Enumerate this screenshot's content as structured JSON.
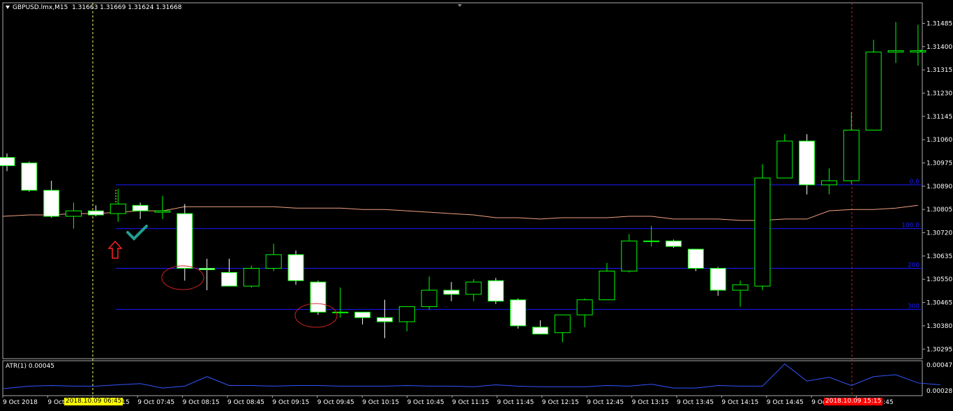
{
  "header": {
    "symbol_label": "GBPUSD.lmx,M15",
    "ohlc_label": "1.31663 1.31669 1.31624 1.31668"
  },
  "indicator": {
    "atr_label": "ATR(1) 0.00045"
  },
  "colors": {
    "background": "#000000",
    "bull_candle": "#00ff00",
    "bear_candle": "#ffffff",
    "ma_line": "#f0a080",
    "level_line": "#1a1aff",
    "atr_line": "#3355ff",
    "crosshair_left": "#ffff66",
    "crosshair_right": "#cc2222",
    "tag_left_bg": "#ffff00",
    "tag_right_bg": "#ff0000",
    "circle": "#cc2222",
    "arrow": "#ff2222",
    "check": "#20a090"
  },
  "price_axis": [
    "1.31485",
    "1.31400",
    "1.31315",
    "1.31230",
    "1.31145",
    "1.31060",
    "1.30975",
    "1.30890",
    "1.30805",
    "1.30720",
    "1.30635",
    "1.30550",
    "1.30465",
    "1.30380",
    "1.30295"
  ],
  "atr_axis": [
    "0.00047",
    "0.00028"
  ],
  "time_axis": [
    "9 Oct 2018",
    "9 Oct 06:45",
    "9 Oct 07:15",
    "9 Oct 07:45",
    "9 Oct 08:15",
    "9 Oct 08:45",
    "9 Oct 09:15",
    "9 Oct 09:45",
    "9 Oct 10:15",
    "9 Oct 10:45",
    "9 Oct 11:15",
    "9 Oct 11:45",
    "9 Oct 12:15",
    "9 Oct 12:45",
    "9 Oct 13:15",
    "9 Oct 13:45",
    "9 Oct 14:15",
    "9 Oct 14:45",
    "9 Oct 15:15",
    "9 Oct 15:45"
  ],
  "level_labels": [
    "0.0",
    "100.0",
    "200",
    "300"
  ],
  "cursor_tags": {
    "left": "2018.10.09 06:45",
    "right": "2018.10.09 15:15"
  },
  "chart_data": {
    "type": "candlestick",
    "symbol": "GBPUSD.lmx",
    "timeframe": "M15",
    "ylim": [
      1.3026,
      1.3156
    ],
    "candles": [
      {
        "o": 1.30995,
        "h": 1.3101,
        "l": 1.30945,
        "c": 1.30965
      },
      {
        "o": 1.30975,
        "h": 1.3098,
        "l": 1.3087,
        "c": 1.30875
      },
      {
        "o": 1.30875,
        "h": 1.3091,
        "l": 1.30775,
        "c": 1.3078
      },
      {
        "o": 1.3078,
        "h": 1.3083,
        "l": 1.30735,
        "c": 1.308
      },
      {
        "o": 1.308,
        "h": 1.3082,
        "l": 1.3078,
        "c": 1.30785
      },
      {
        "o": 1.3079,
        "h": 1.3088,
        "l": 1.3076,
        "c": 1.30825
      },
      {
        "o": 1.3082,
        "h": 1.3083,
        "l": 1.3077,
        "c": 1.308
      },
      {
        "o": 1.30795,
        "h": 1.30855,
        "l": 1.3077,
        "c": 1.308
      },
      {
        "o": 1.3079,
        "h": 1.30825,
        "l": 1.30545,
        "c": 1.3059
      },
      {
        "o": 1.3059,
        "h": 1.30625,
        "l": 1.3051,
        "c": 1.30585
      },
      {
        "o": 1.30575,
        "h": 1.30625,
        "l": 1.30525,
        "c": 1.30525
      },
      {
        "o": 1.30525,
        "h": 1.306,
        "l": 1.3052,
        "c": 1.3059
      },
      {
        "o": 1.3059,
        "h": 1.3068,
        "l": 1.3058,
        "c": 1.3064
      },
      {
        "o": 1.3064,
        "h": 1.30655,
        "l": 1.3053,
        "c": 1.30545
      },
      {
        "o": 1.3054,
        "h": 1.30545,
        "l": 1.3042,
        "c": 1.3043
      },
      {
        "o": 1.3043,
        "h": 1.3052,
        "l": 1.3041,
        "c": 1.3043
      },
      {
        "o": 1.3043,
        "h": 1.3043,
        "l": 1.30385,
        "c": 1.3041
      },
      {
        "o": 1.3041,
        "h": 1.30475,
        "l": 1.30335,
        "c": 1.30395
      },
      {
        "o": 1.30395,
        "h": 1.3044,
        "l": 1.3036,
        "c": 1.3045
      },
      {
        "o": 1.3045,
        "h": 1.3056,
        "l": 1.3044,
        "c": 1.3051
      },
      {
        "o": 1.3051,
        "h": 1.3054,
        "l": 1.3047,
        "c": 1.30495
      },
      {
        "o": 1.30495,
        "h": 1.3055,
        "l": 1.3047,
        "c": 1.3054
      },
      {
        "o": 1.30545,
        "h": 1.30555,
        "l": 1.3046,
        "c": 1.3047
      },
      {
        "o": 1.30475,
        "h": 1.3048,
        "l": 1.3037,
        "c": 1.3038
      },
      {
        "o": 1.30375,
        "h": 1.304,
        "l": 1.3035,
        "c": 1.3035
      },
      {
        "o": 1.30355,
        "h": 1.3042,
        "l": 1.3032,
        "c": 1.3042
      },
      {
        "o": 1.3042,
        "h": 1.3048,
        "l": 1.30375,
        "c": 1.30475
      },
      {
        "o": 1.30475,
        "h": 1.3061,
        "l": 1.30475,
        "c": 1.3058
      },
      {
        "o": 1.3058,
        "h": 1.30715,
        "l": 1.30575,
        "c": 1.3069
      },
      {
        "o": 1.3069,
        "h": 1.30745,
        "l": 1.3067,
        "c": 1.3069
      },
      {
        "o": 1.3069,
        "h": 1.30695,
        "l": 1.30665,
        "c": 1.3067
      },
      {
        "o": 1.3066,
        "h": 1.3066,
        "l": 1.3058,
        "c": 1.3059
      },
      {
        "o": 1.3059,
        "h": 1.30595,
        "l": 1.3049,
        "c": 1.3051
      },
      {
        "o": 1.3051,
        "h": 1.30545,
        "l": 1.3045,
        "c": 1.3053
      },
      {
        "o": 1.30525,
        "h": 1.3097,
        "l": 1.3051,
        "c": 1.3092
      },
      {
        "o": 1.3092,
        "h": 1.3108,
        "l": 1.3092,
        "c": 1.31055
      },
      {
        "o": 1.31055,
        "h": 1.3108,
        "l": 1.3086,
        "c": 1.30895
      },
      {
        "o": 1.30895,
        "h": 1.30955,
        "l": 1.3086,
        "c": 1.3091
      },
      {
        "o": 1.3091,
        "h": 1.3116,
        "l": 1.309,
        "c": 1.31095
      },
      {
        "o": 1.31095,
        "h": 1.31425,
        "l": 1.31095,
        "c": 1.3138
      },
      {
        "o": 1.3138,
        "h": 1.3149,
        "l": 1.3134,
        "c": 1.31385
      },
      {
        "o": 1.3138,
        "h": 1.3148,
        "l": 1.3133,
        "c": 1.31385
      }
    ],
    "moving_average": [
      1.3078,
      1.30785,
      1.30785,
      1.3079,
      1.3079,
      1.30795,
      1.308,
      1.308,
      1.30815,
      1.30815,
      1.30815,
      1.30815,
      1.30815,
      1.3081,
      1.3081,
      1.3081,
      1.30805,
      1.30805,
      1.308,
      1.30795,
      1.3079,
      1.30785,
      1.30775,
      1.30775,
      1.3077,
      1.30775,
      1.30775,
      1.30775,
      1.3078,
      1.3078,
      1.3077,
      1.3077,
      1.3077,
      1.30765,
      1.30765,
      1.3077,
      1.3077,
      1.308,
      1.30805,
      1.30805,
      1.3081,
      1.3082
    ],
    "levels": [
      1.30895,
      1.30735,
      1.3059,
      1.3044
    ],
    "atr_values": [
      0.00026,
      0.0003,
      0.00031,
      0.0003,
      0.0003,
      0.00032,
      0.00034,
      0.00027,
      0.0003,
      0.00045,
      0.00031,
      0.00031,
      0.0003,
      0.00031,
      0.00031,
      0.0003,
      0.0003,
      0.0003,
      0.00031,
      0.0003,
      0.0003,
      0.00029,
      0.00032,
      0.0003,
      0.00029,
      0.00029,
      0.00029,
      0.00031,
      0.0003,
      0.00033,
      0.00027,
      0.00027,
      0.00031,
      0.0003,
      0.0003,
      0.00065,
      0.00038,
      0.00044,
      0.00031,
      0.00045,
      0.00048,
      0.00035,
      0.00032
    ],
    "atr_ylim": [
      0.00015,
      0.0007
    ]
  }
}
